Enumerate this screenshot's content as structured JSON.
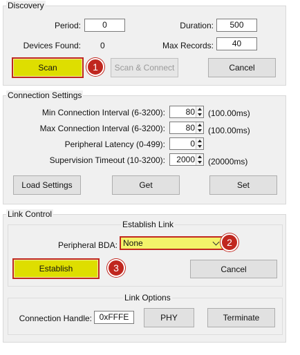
{
  "discovery": {
    "title": "Discovery",
    "period_label": "Period:",
    "period_value": "0",
    "duration_label": "Duration:",
    "duration_value": "500",
    "devices_found_label": "Devices Found:",
    "devices_found_value": "0",
    "max_records_label": "Max Records:",
    "max_records_value": "40",
    "scan_label": "Scan",
    "scan_connect_label": "Scan & Connect",
    "cancel_label": "Cancel"
  },
  "connection": {
    "title": "Connection Settings",
    "min_interval_label": "Min Connection Interval (6-3200):",
    "min_interval_value": "80",
    "min_interval_unit": "(100.00ms)",
    "max_interval_label": "Max Connection Interval (6-3200):",
    "max_interval_value": "80",
    "max_interval_unit": "(100.00ms)",
    "latency_label": "Peripheral Latency (0-499):",
    "latency_value": "0",
    "timeout_label": "Supervision Timeout (10-3200):",
    "timeout_value": "2000",
    "timeout_unit": "(20000ms)",
    "load_label": "Load Settings",
    "get_label": "Get",
    "set_label": "Set"
  },
  "link_control": {
    "title": "Link Control",
    "establish_title": "Establish Link",
    "bda_label": "Peripheral BDA:",
    "bda_value": "None",
    "establish_label": "Establish",
    "cancel_label": "Cancel",
    "options_title": "Link Options",
    "handle_label": "Connection Handle:",
    "handle_value": "0xFFFE",
    "phy_label": "PHY",
    "terminate_label": "Terminate"
  },
  "callouts": {
    "c1": "1",
    "c2": "2",
    "c3": "3"
  },
  "colors": {
    "highlight_fill": "#dede00",
    "highlight_border": "#c0271f",
    "callout": "#c0271f"
  }
}
